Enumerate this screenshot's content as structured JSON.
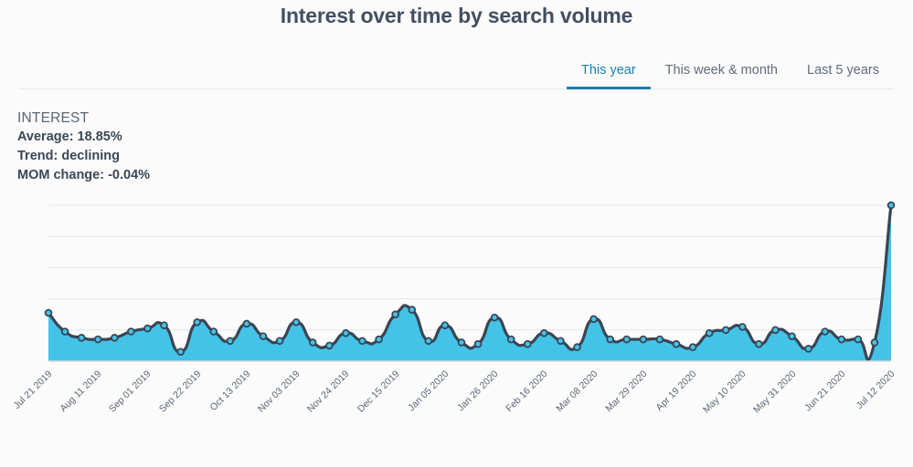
{
  "header": {
    "title": "Interest over time by search volume"
  },
  "tabs": [
    {
      "label": "This year",
      "active": true
    },
    {
      "label": "This week & month",
      "active": false
    },
    {
      "label": "Last 5 years",
      "active": false
    }
  ],
  "stats": {
    "heading": "INTEREST",
    "average_label": "Average: 18.85%",
    "trend_label": "Trend: declining",
    "mom_label": "MOM change: -0.04%"
  },
  "colors": {
    "accent": "#1b7fa8",
    "area_fill": "#44c3e8",
    "line": "#3a4553",
    "marker_fill": "#44c3e8",
    "marker_stroke": "#3a4553",
    "grid": "#e6e8eb",
    "title_text": "#434f61",
    "body_text": "#3b4757",
    "muted_text": "#5a6675",
    "page_background": "#fbfbfc"
  },
  "chart_data": {
    "type": "area",
    "title": "Interest over time by search volume",
    "xlabel": "",
    "ylabel": "Interest",
    "ylim": [
      0,
      100
    ],
    "grid": true,
    "legend": "none",
    "series_name": "Interest",
    "tick_labels": [
      "Jul 21 2019",
      "Aug 11 2019",
      "Sep 01 2019",
      "Sep 22 2019",
      "Oct 13 2019",
      "Nov 03 2019",
      "Nov 24 2019",
      "Dec 15 2019",
      "Jan 05 2020",
      "Jan 26 2020",
      "Feb 16 2020",
      "Mar 08 2020",
      "Mar 29 2020",
      "Apr 19 2020",
      "May 10 2020",
      "May 31 2020",
      "Jun 21 2020",
      "Jul 12 2020"
    ],
    "tick_indices": [
      0,
      3,
      6,
      9,
      12,
      15,
      18,
      21,
      24,
      27,
      30,
      33,
      36,
      39,
      42,
      45,
      48,
      51
    ],
    "x": [
      "Jul 21 2019",
      "Jul 28 2019",
      "Aug 04 2019",
      "Aug 11 2019",
      "Aug 18 2019",
      "Aug 25 2019",
      "Sep 01 2019",
      "Sep 08 2019",
      "Sep 15 2019",
      "Sep 22 2019",
      "Sep 29 2019",
      "Oct 06 2019",
      "Oct 13 2019",
      "Oct 20 2019",
      "Oct 27 2019",
      "Nov 03 2019",
      "Nov 10 2019",
      "Nov 17 2019",
      "Nov 24 2019",
      "Dec 01 2019",
      "Dec 08 2019",
      "Dec 15 2019",
      "Dec 22 2019",
      "Dec 29 2019",
      "Jan 05 2020",
      "Jan 12 2020",
      "Jan 19 2020",
      "Jan 26 2020",
      "Feb 02 2020",
      "Feb 09 2020",
      "Feb 16 2020",
      "Feb 23 2020",
      "Mar 01 2020",
      "Mar 08 2020",
      "Mar 15 2020",
      "Mar 22 2020",
      "Mar 29 2020",
      "Apr 05 2020",
      "Apr 12 2020",
      "Apr 19 2020",
      "Apr 26 2020",
      "May 03 2020",
      "May 10 2020",
      "May 17 2020",
      "May 24 2020",
      "May 31 2020",
      "Jun 07 2020",
      "Jun 14 2020",
      "Jun 21 2020",
      "Jun 28 2020",
      "Jul 05 2020",
      "Jul 12 2020"
    ],
    "values": [
      31,
      19,
      15,
      14,
      15,
      19,
      21,
      23,
      6,
      25,
      19,
      13,
      24,
      16,
      13,
      25,
      12,
      10,
      18,
      13,
      14,
      30,
      33,
      13,
      23,
      12,
      11,
      28,
      14,
      11,
      18,
      13,
      9,
      27,
      14,
      14,
      14,
      14,
      11,
      9,
      18,
      20,
      22,
      11,
      20,
      16,
      8,
      19,
      14,
      14,
      12,
      100
    ]
  }
}
